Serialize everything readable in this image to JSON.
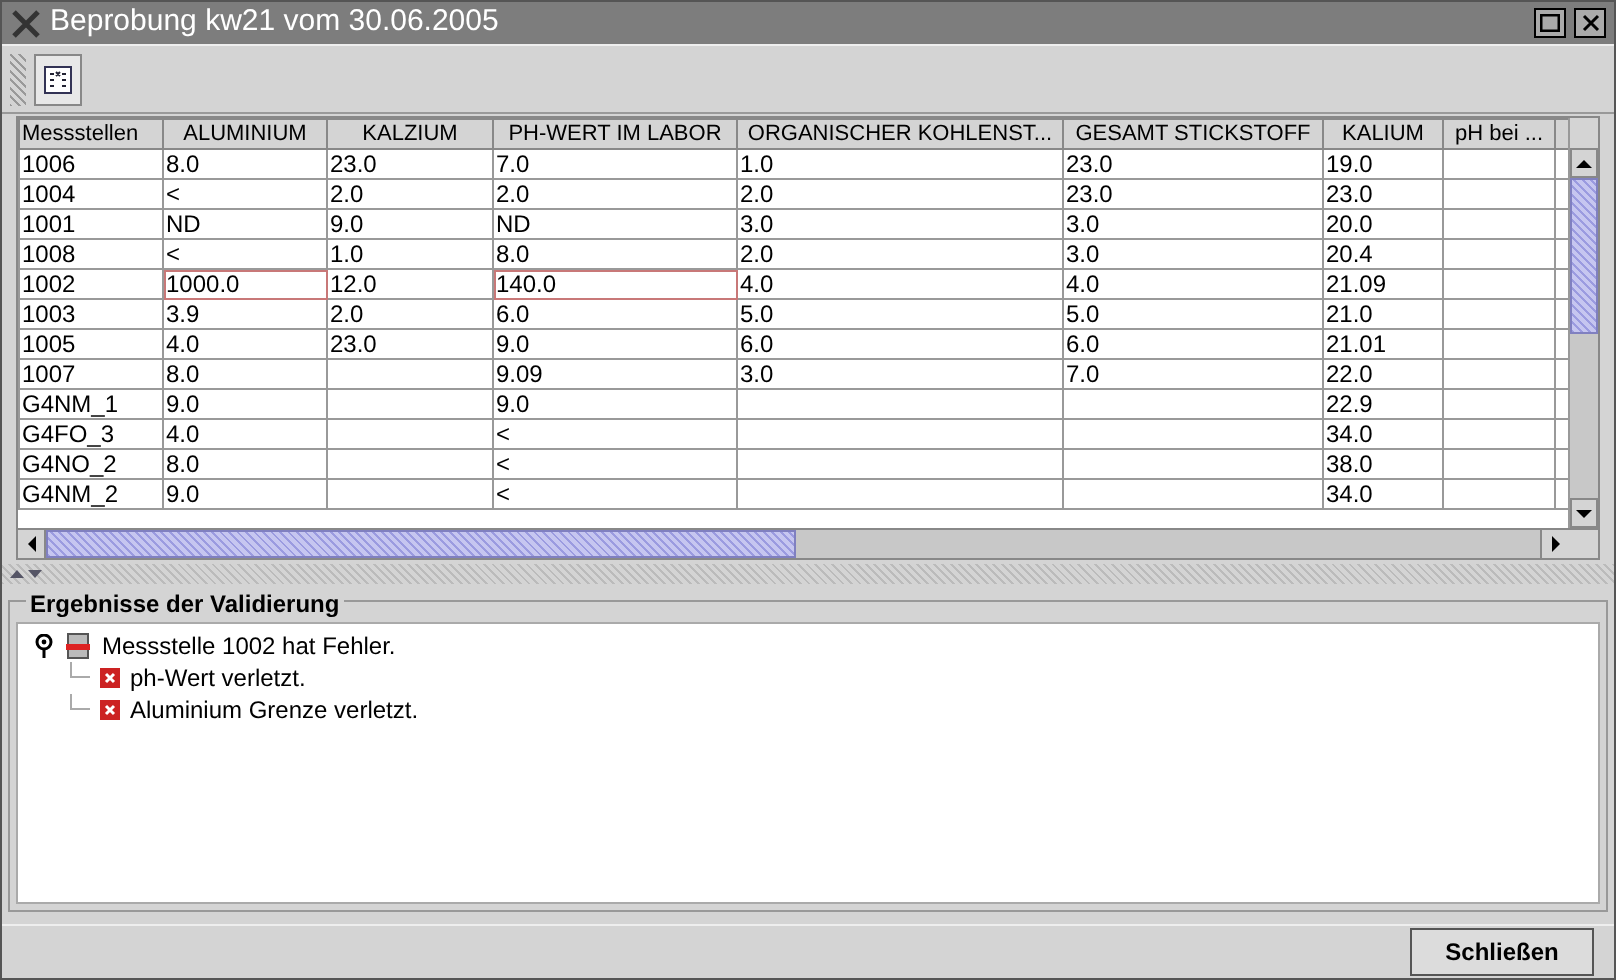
{
  "window": {
    "title": "Beprobung kw21 vom 30.06.2005"
  },
  "table": {
    "columns": [
      "Messstellen",
      "ALUMINIUM",
      "KALZIUM",
      "PH-WERT IM LABOR",
      "ORGANISCHER KOHLENST...",
      "GESAMT STICKSTOFF",
      "KALIUM",
      "pH bei ..."
    ],
    "rows": [
      {
        "cells": [
          "1006",
          "8.0",
          "23.0",
          "7.0",
          "1.0",
          "23.0",
          "19.0",
          ""
        ]
      },
      {
        "cells": [
          "1004",
          "<",
          "2.0",
          "2.0",
          "2.0",
          "23.0",
          "23.0",
          ""
        ]
      },
      {
        "cells": [
          "1001",
          "ND",
          "9.0",
          "ND",
          "3.0",
          "3.0",
          "20.0",
          ""
        ]
      },
      {
        "cells": [
          "1008",
          "<",
          "1.0",
          "8.0",
          "2.0",
          "3.0",
          "20.4",
          ""
        ]
      },
      {
        "cells": [
          "1002",
          "1000.0",
          "12.0",
          "140.0",
          "4.0",
          "4.0",
          "21.09",
          ""
        ],
        "errors": [
          false,
          true,
          false,
          true,
          false,
          false,
          false,
          false
        ]
      },
      {
        "cells": [
          "1003",
          "3.9",
          "2.0",
          "6.0",
          "5.0",
          "5.0",
          "21.0",
          ""
        ]
      },
      {
        "cells": [
          "1005",
          "4.0",
          "23.0",
          "9.0",
          "6.0",
          "6.0",
          "21.01",
          ""
        ]
      },
      {
        "cells": [
          "1007",
          "8.0",
          "",
          "9.09",
          "3.0",
          "7.0",
          "22.0",
          ""
        ]
      },
      {
        "cells": [
          "G4NM_1",
          "9.0",
          "",
          "9.0",
          "",
          "",
          "22.9",
          ""
        ]
      },
      {
        "cells": [
          "G4FO_3",
          "4.0",
          "",
          "<",
          "",
          "",
          "34.0",
          ""
        ]
      },
      {
        "cells": [
          "G4NO_2",
          "8.0",
          "",
          "<",
          "",
          "",
          "38.0",
          ""
        ]
      },
      {
        "cells": [
          "G4NM_2",
          "9.0",
          "",
          "<",
          "",
          "",
          "34.0",
          ""
        ]
      }
    ]
  },
  "validation": {
    "title": "Ergebnisse der Validierung",
    "tree": [
      {
        "label": "Messstelle 1002 hat Fehler.",
        "kind": "station",
        "expanded": true,
        "children": [
          {
            "label": "ph-Wert verletzt.",
            "kind": "error"
          },
          {
            "label": "Aluminium Grenze verletzt.",
            "kind": "error"
          }
        ]
      }
    ]
  },
  "buttons": [
    "Schließen"
  ]
}
